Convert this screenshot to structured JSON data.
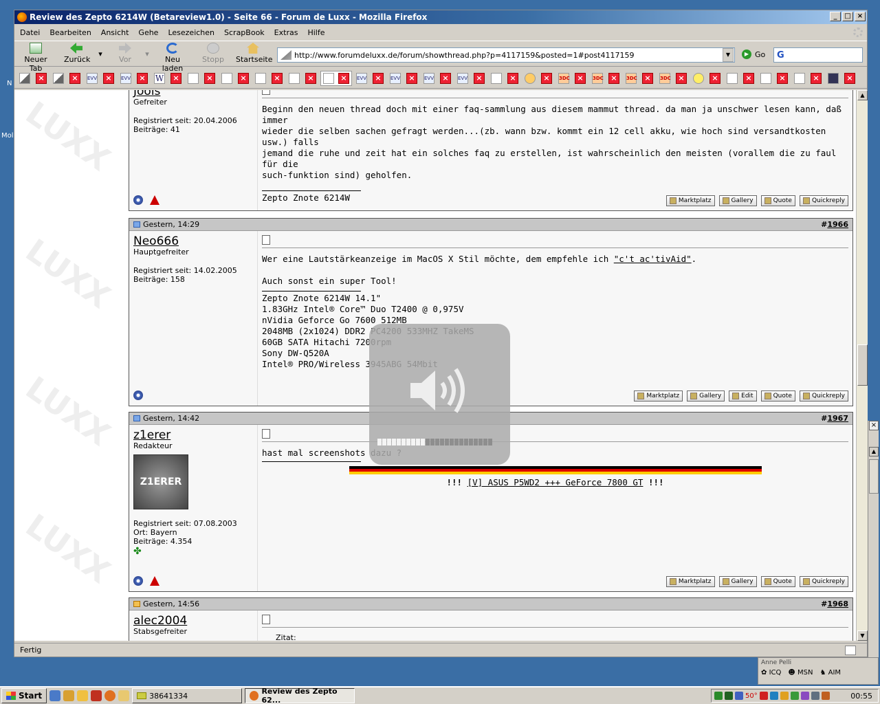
{
  "window": {
    "title": "Review des Zepto 6214W (Betareview1.0) - Seite 66 - Forum de Luxx - Mozilla Firefox"
  },
  "menu": [
    "Datei",
    "Bearbeiten",
    "Ansicht",
    "Gehe",
    "Lesezeichen",
    "ScrapBook",
    "Extras",
    "Hilfe"
  ],
  "nav": {
    "new_tab": "Neuer Tab",
    "back": "Zurück",
    "forward": "Vor",
    "reload": "Neu laden",
    "stop": "Stopp",
    "home": "Startseite",
    "url": "http://www.forumdeluxx.de/forum/showthread.php?p=4117159&posted=1#post4117159",
    "go": "Go"
  },
  "posts": [
    {
      "date": "",
      "number": "",
      "username": "Jools",
      "rank": "Gefreiter",
      "registered": "Registriert seit: 20.04.2006",
      "extra": "",
      "posts": "Beiträge: 41",
      "message_lines": [
        "Beginn den neuen thread doch mit einer faq-sammlung aus diesem mammut thread. da man ja unschwer lesen kann, daß immer",
        "wieder die selben sachen gefragt werden...(zb. wann bzw. kommt ein 12 cell akku, wie hoch sind versandtkosten usw.) falls",
        "jemand die ruhe und zeit hat ein solches faq zu erstellen, ist wahrscheinlich den meisten (vorallem die zu faul für die",
        "such-funktion sind) geholfen."
      ],
      "signature_lines": [
        "Zepto Znote 6214W"
      ]
    },
    {
      "date": "Gestern, 14:29",
      "number": "1966",
      "username": "Neo666",
      "rank": "Hauptgefreiter",
      "registered": "Registriert seit: 14.02.2005",
      "extra": "",
      "posts": "Beiträge: 158",
      "message_pre": "Wer eine Lautstärkeanzeige im MacOS X Stil möchte, dem empfehle ich ",
      "message_link": "\"c't ac'tivAid\"",
      "message_post": ".",
      "message_line2": "Auch sonst ein super Tool!",
      "signature_lines": [
        "Zepto Znote 6214W 14.1\"",
        "1.83GHz Intel® Core™ Duo T2400 @ 0,975V",
        "nVidia Geforce Go 7600 512MB",
        "2048MB (2x1024) DDR2 PC4200 533MHZ TakeMS",
        "60GB SATA Hitachi 7200rpm",
        "Sony DW-Q520A",
        "Intel® PRO/Wireless 3945ABG 54Mbit"
      ]
    },
    {
      "date": "Gestern, 14:42",
      "number": "1967",
      "username": "z1erer",
      "rank": "Redakteur",
      "registered": "Registriert seit: 07.08.2003",
      "extra": "Ort: Bayern",
      "posts": "Beiträge: 4.354",
      "avatar_text": "Z1ERER",
      "message_lines": [
        "hast mal screenshots dazu ?"
      ],
      "sig_prefix": "!!! ",
      "sig_link": "[V] ASUS P5WD2 +++ GeForce 7800 GT",
      "sig_suffix": " !!!"
    },
    {
      "date": "Gestern, 14:56",
      "number": "1968",
      "username": "alec2004",
      "rank": "Stabsgefreiter",
      "quote_label": "Zitat:"
    }
  ],
  "post_buttons": {
    "marktplatz": "Marktplatz",
    "gallery": "Gallery",
    "edit": "Edit",
    "quote": "Quote",
    "quickreply": "Quickreply"
  },
  "status": "Fertig",
  "im": {
    "header": "Anne Pelli",
    "icq": "ICQ",
    "msn": "MSN",
    "aim": "AIM"
  },
  "taskbar": {
    "start": "Start",
    "task1": "38641334",
    "task2": "Review des Zepto 62...",
    "tray_temp": "50°",
    "clock": "00:55"
  },
  "desktop": {
    "label1": "N",
    "label2": "Mol"
  },
  "volume": {
    "level_fraction": 0.42
  }
}
